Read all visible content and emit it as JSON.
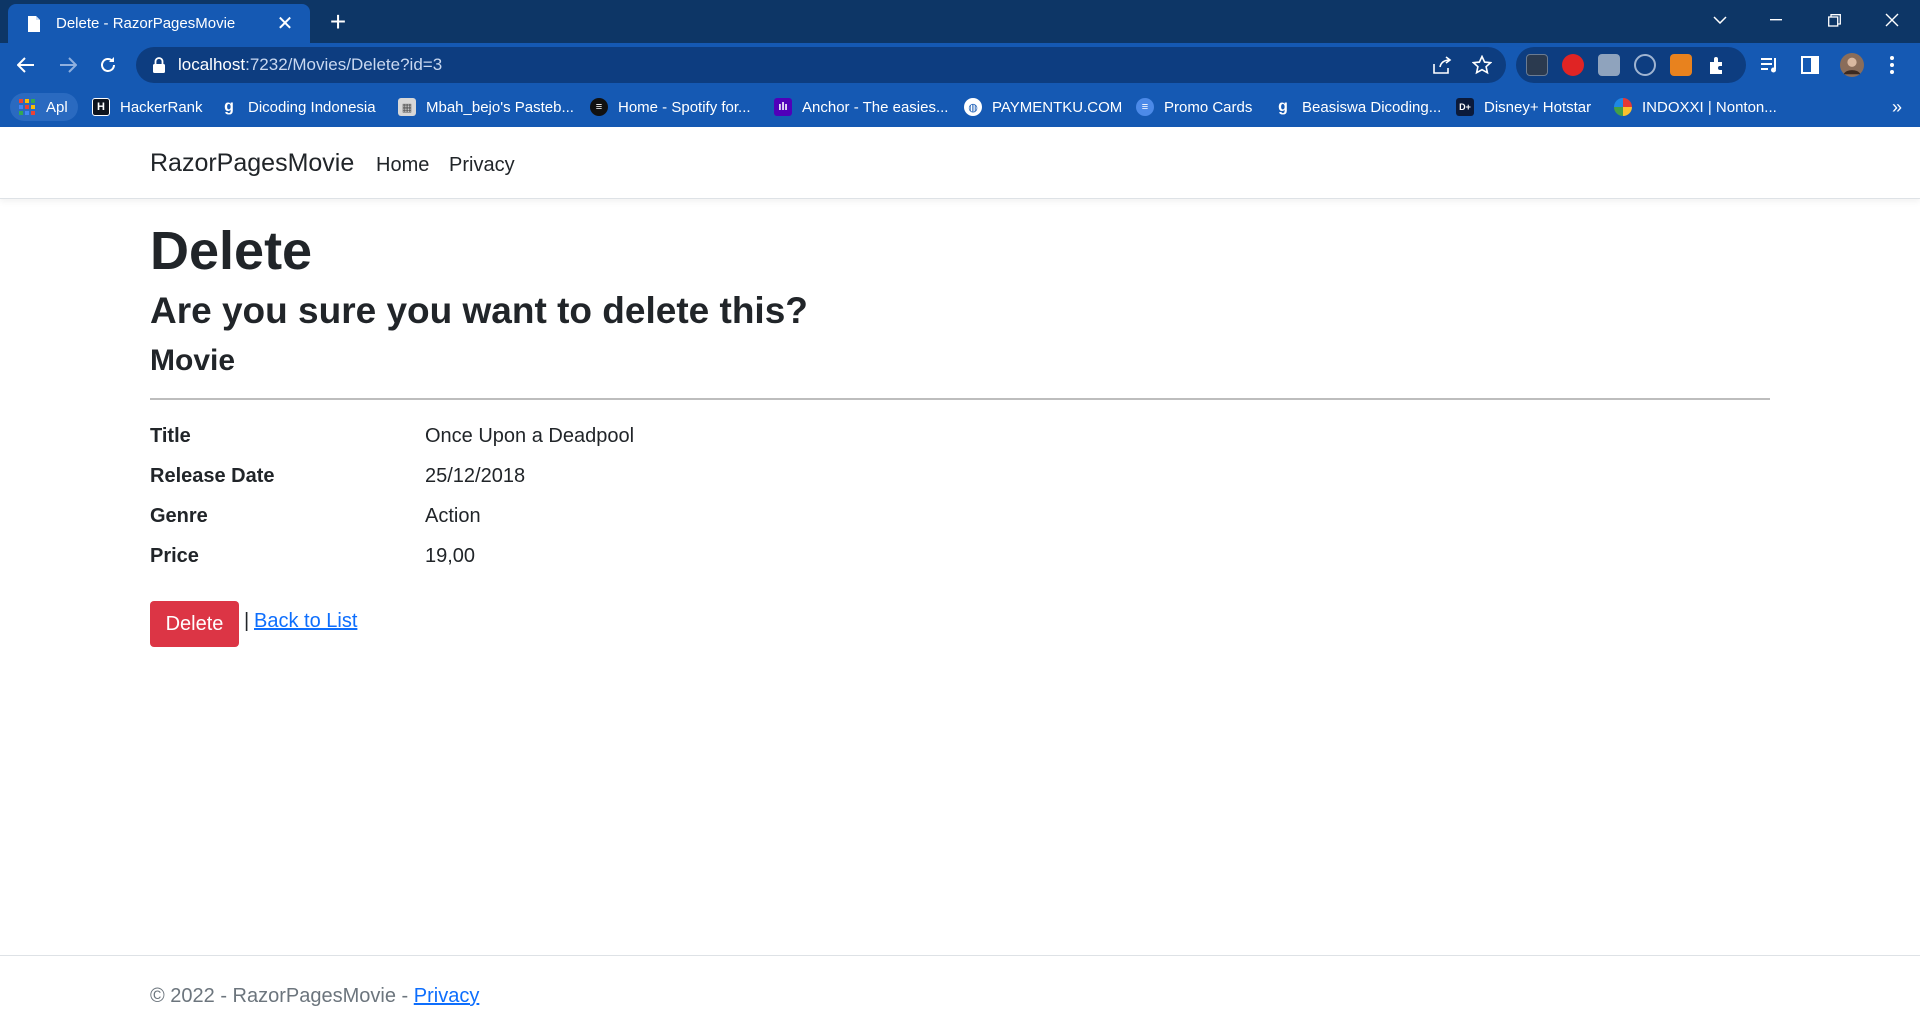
{
  "browser": {
    "tab_title": "Delete - RazorPagesMovie",
    "url_host": "localhost",
    "url_path": ":7232/Movies/Delete?id=3",
    "bookmarks": [
      {
        "label": "Apl",
        "icon": "apps-grid-icon"
      },
      {
        "label": "HackerRank",
        "icon": "hackerrank-icon"
      },
      {
        "label": "Dicoding Indonesia",
        "icon": "dicoding-icon"
      },
      {
        "label": "Mbah_bejo's Pasteb...",
        "icon": "pastebin-icon"
      },
      {
        "label": "Home - Spotify for...",
        "icon": "spotify-icon"
      },
      {
        "label": "Anchor - The easies...",
        "icon": "anchor-icon"
      },
      {
        "label": "PAYMENTKU.COM",
        "icon": "globe-icon"
      },
      {
        "label": "Promo Cards",
        "icon": "promo-icon"
      },
      {
        "label": "Beasiswa Dicoding...",
        "icon": "dicoding-icon"
      },
      {
        "label": "Disney+ Hotstar",
        "icon": "hotstar-icon"
      },
      {
        "label": "INDOXXI | Nonton...",
        "icon": "indoxxi-icon"
      }
    ],
    "bookmarks_more": "»"
  },
  "navbar": {
    "brand": "RazorPagesMovie",
    "links": [
      "Home",
      "Privacy"
    ]
  },
  "page": {
    "title": "Delete",
    "question": "Are you sure you want to delete this?",
    "entity": "Movie",
    "fields": [
      {
        "label": "Title",
        "value": "Once Upon a Deadpool"
      },
      {
        "label": "Release Date",
        "value": "25/12/2018"
      },
      {
        "label": "Genre",
        "value": "Action"
      },
      {
        "label": "Price",
        "value": "19,00"
      }
    ],
    "delete_label": "Delete",
    "separator": "|",
    "back_label": "Back to List"
  },
  "footer": {
    "text": "© 2022 - RazorPagesMovie - ",
    "privacy_label": "Privacy"
  },
  "colors": {
    "chrome_dark": "#0d3666",
    "chrome": "#1559b3",
    "danger": "#dc3545",
    "link": "#0d6efd"
  }
}
